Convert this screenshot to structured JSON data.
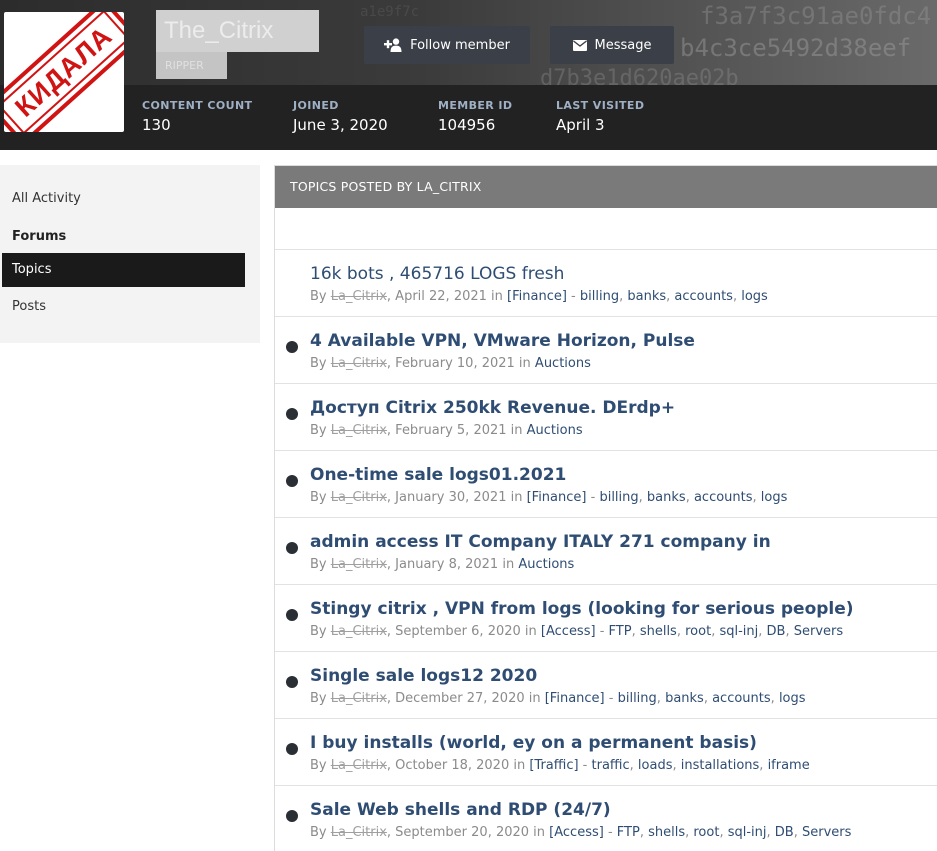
{
  "profile": {
    "username": "The_Citrix",
    "user_title": "RIPPER",
    "avatar_stamp_text": "КИДАЛА",
    "background_text": [
      "f3a7f3c91ae0fdc4",
      "b4c3ce5492d38eef",
      "d7b3e1d620ae02b",
      "a1e9f7c"
    ],
    "buttons": {
      "follow": "Follow member",
      "message": "Message"
    },
    "stats": [
      {
        "label": "CONTENT COUNT",
        "value": "130"
      },
      {
        "label": "JOINED",
        "value": "June 3, 2020"
      },
      {
        "label": "MEMBER ID",
        "value": "104956"
      },
      {
        "label": "LAST VISITED",
        "value": "April 3"
      }
    ]
  },
  "sidebar": {
    "all_activity": "All Activity",
    "section": "Forums",
    "items": [
      {
        "label": "Topics",
        "active": true
      },
      {
        "label": "Posts",
        "active": false
      }
    ]
  },
  "main": {
    "header": "TOPICS POSTED BY LA_CITRIX",
    "topics": [
      {
        "title": "16k bots , 465716 LOGS fresh",
        "unread": false,
        "by": "By ",
        "author": "La_Citrix",
        "date": ", April 22, 2021 in ",
        "forum": "[Finance]",
        "tags": [
          " - ",
          "billing",
          ", ",
          "banks",
          ", ",
          "accounts",
          ", ",
          "logs"
        ]
      },
      {
        "title": "4 Available VPN, VMware Horizon, Pulse",
        "unread": true,
        "by": "By ",
        "author": "La_Citrix",
        "date": ", February 10, 2021 in ",
        "forum": "Auctions",
        "tags": []
      },
      {
        "title": "Доступ Citrix 250kk Revenue. DErdp+",
        "unread": true,
        "by": "By ",
        "author": "La_Citrix",
        "date": ", February 5, 2021 in ",
        "forum": "Auctions",
        "tags": []
      },
      {
        "title": "One-time sale logs01.2021",
        "unread": true,
        "by": "By ",
        "author": "La_Citrix",
        "date": ", January 30, 2021 in ",
        "forum": "[Finance]",
        "tags": [
          " - ",
          "billing",
          ", ",
          "banks",
          ", ",
          "accounts",
          ", ",
          "logs"
        ]
      },
      {
        "title": "admin access IT Company ITALY 271 company in",
        "unread": true,
        "by": "By ",
        "author": "La_Citrix",
        "date": ", January 8, 2021 in ",
        "forum": "Auctions",
        "tags": []
      },
      {
        "title": "Stingy citrix , VPN from logs (looking for serious people)",
        "unread": true,
        "by": "By ",
        "author": "La_Citrix",
        "date": ", September 6, 2020 in ",
        "forum": "[Access]",
        "tags": [
          " - ",
          "FTP",
          ", ",
          "shells",
          ", ",
          "root",
          ", ",
          "sql-inj",
          ", ",
          "DB",
          ", ",
          "Servers"
        ]
      },
      {
        "title": "Single sale logs12 2020",
        "unread": true,
        "by": "By ",
        "author": "La_Citrix",
        "date": ", December 27, 2020 in ",
        "forum": "[Finance]",
        "tags": [
          " - ",
          "billing",
          ", ",
          "banks",
          ", ",
          "accounts",
          ", ",
          "logs"
        ]
      },
      {
        "title": "I buy installs (world, ey on a permanent basis)",
        "unread": true,
        "by": "By ",
        "author": "La_Citrix",
        "date": ", October 18, 2020 in ",
        "forum": "[Traffic]",
        "tags": [
          " - ",
          "traffic",
          ", ",
          "loads",
          ", ",
          "installations",
          ", ",
          "iframe"
        ]
      },
      {
        "title": "Sale Web shells and RDP (24/7)",
        "unread": true,
        "by": "By ",
        "author": "La_Citrix",
        "date": ", September 20, 2020 in ",
        "forum": "[Access]",
        "tags": [
          " - ",
          "FTP",
          ", ",
          "shells",
          ", ",
          "root",
          ", ",
          "sql-inj",
          ", ",
          "DB",
          ", ",
          "Servers"
        ]
      }
    ]
  },
  "colors": {
    "link": "#2f4d73",
    "header_bar": "#222222",
    "active_nav": "#1a1a1a",
    "stamp_red": "#d01414"
  }
}
